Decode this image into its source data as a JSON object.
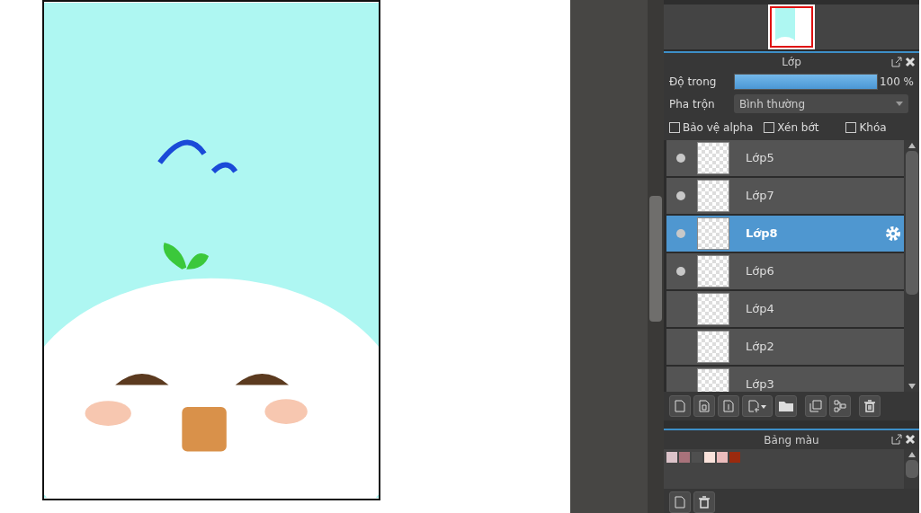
{
  "layer_panel": {
    "title": "Lớp",
    "opacity": {
      "label": "Độ trong",
      "level": 1.0,
      "reading": "100 %"
    },
    "blend": {
      "label": "Pha trộn",
      "value": "Bình thường"
    },
    "options": [
      {
        "label": "Bảo vệ alpha",
        "checked": false
      },
      {
        "label": "Xén bớt",
        "checked": false
      },
      {
        "label": "Khóa",
        "checked": false
      }
    ],
    "layers": [
      {
        "name": "Lớp5",
        "visible": true,
        "selected": false
      },
      {
        "name": "Lớp7",
        "visible": true,
        "selected": false
      },
      {
        "name": "Lớp8",
        "visible": true,
        "selected": true
      },
      {
        "name": "Lớp6",
        "visible": true,
        "selected": false
      },
      {
        "name": "Lớp4",
        "visible": false,
        "selected": false
      },
      {
        "name": "Lớp2",
        "visible": false,
        "selected": false
      },
      {
        "name": "Lớp3",
        "visible": false,
        "selected": false
      }
    ]
  },
  "palette_panel": {
    "title": "Bảng màu",
    "swatches": [
      {
        "color": "#dcc3c9"
      },
      {
        "color": "#a8727a"
      },
      {
        "color": "#4f4f4f"
      },
      {
        "color": "#fbe3dc"
      },
      {
        "color": "#ecbcbc"
      },
      {
        "color": "#9b2a0e"
      }
    ]
  }
}
